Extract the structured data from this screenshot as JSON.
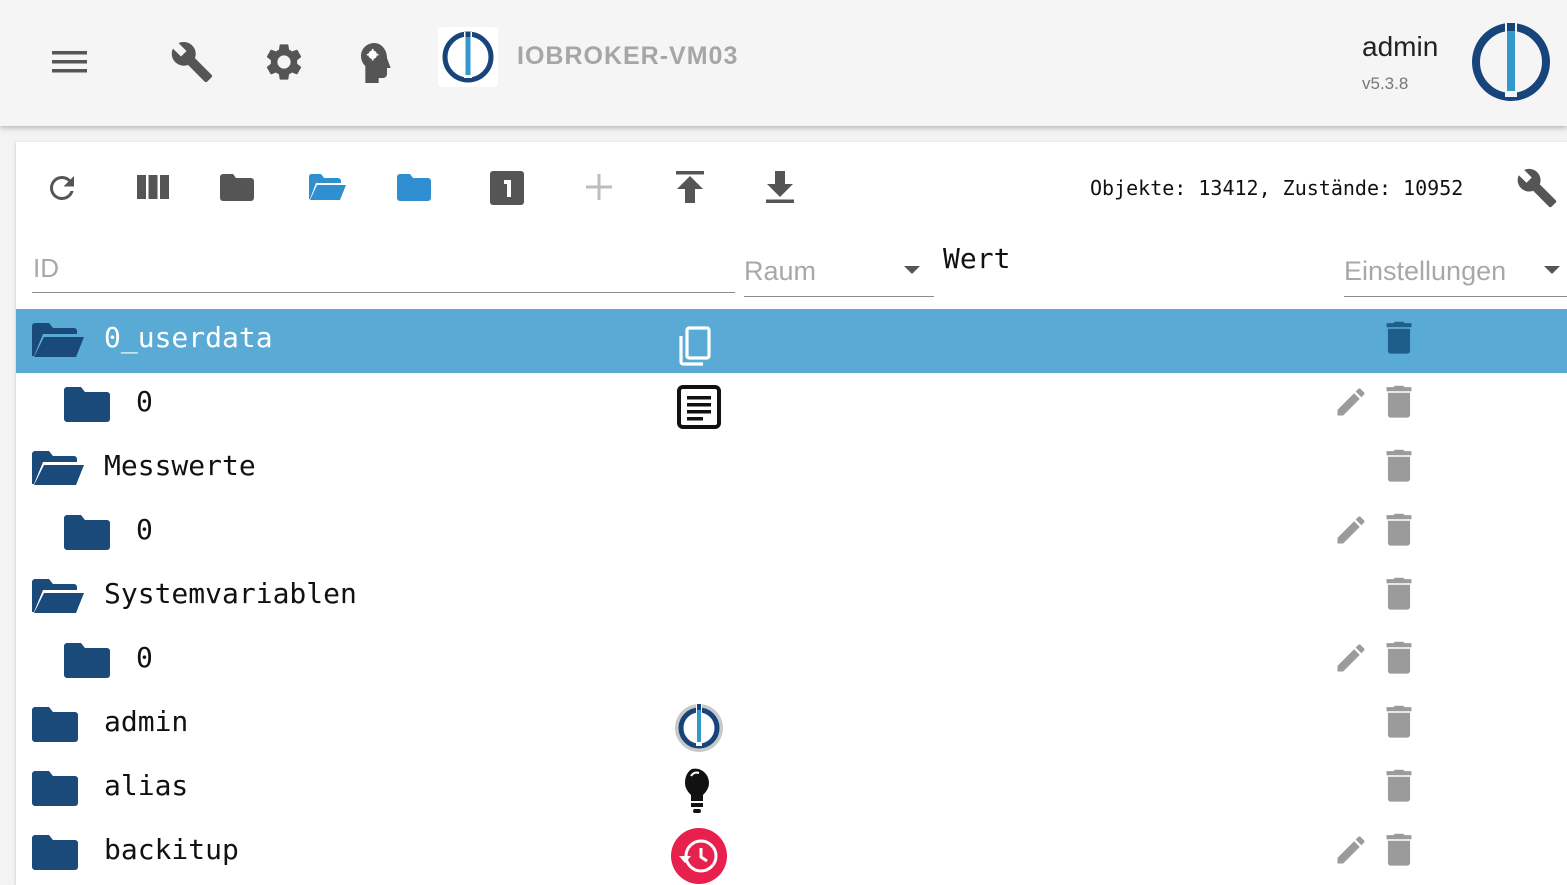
{
  "header": {
    "title": "IOBROKER-VM03",
    "user": "admin",
    "version": "v5.3.8",
    "icons": [
      "menu-icon",
      "wrench-icon",
      "gear-icon",
      "expert-head-icon",
      "iobroker-logo-icon",
      "iobroker-big-logo"
    ]
  },
  "toolbar": {
    "icons": [
      "refresh-icon",
      "columns-icon",
      "folder-icon",
      "folder-open-icon",
      "folder-blue-icon",
      "one-level-icon",
      "add-icon",
      "upload-icon",
      "download-icon",
      "wrench-icon"
    ],
    "counts": "Objekte: 13412, Zustände: 10952"
  },
  "filters": {
    "id_placeholder": "ID",
    "room_label": "Raum",
    "value_label": "Wert",
    "settings_label": "Einstellungen"
  },
  "tree": [
    {
      "name": "0_userdata",
      "level": 0,
      "open": true,
      "selected": true,
      "icon": "copy-icon",
      "editable": false
    },
    {
      "name": "0",
      "level": 1,
      "open": false,
      "selected": false,
      "icon": "document-icon",
      "editable": true
    },
    {
      "name": "Messwerte",
      "level": 0,
      "open": true,
      "selected": false,
      "icon": "",
      "editable": false
    },
    {
      "name": "0",
      "level": 1,
      "open": false,
      "selected": false,
      "icon": "",
      "editable": true
    },
    {
      "name": "Systemvariablen",
      "level": 0,
      "open": true,
      "selected": false,
      "icon": "",
      "editable": false
    },
    {
      "name": "0",
      "level": 1,
      "open": false,
      "selected": false,
      "icon": "",
      "editable": true
    },
    {
      "name": "admin",
      "level": 0,
      "open": false,
      "selected": false,
      "icon": "admin-logo-icon",
      "editable": false
    },
    {
      "name": "alias",
      "level": 0,
      "open": false,
      "selected": false,
      "icon": "lightbulb-icon",
      "editable": false
    },
    {
      "name": "backitup",
      "level": 0,
      "open": false,
      "selected": false,
      "icon": "backup-clock-icon",
      "editable": true
    }
  ],
  "colors": {
    "selected_row": "#5aaad6",
    "folder": "#1a4a7a",
    "accent_blue": "#2f8fd0",
    "icon_grey": "#9b9b9b"
  }
}
